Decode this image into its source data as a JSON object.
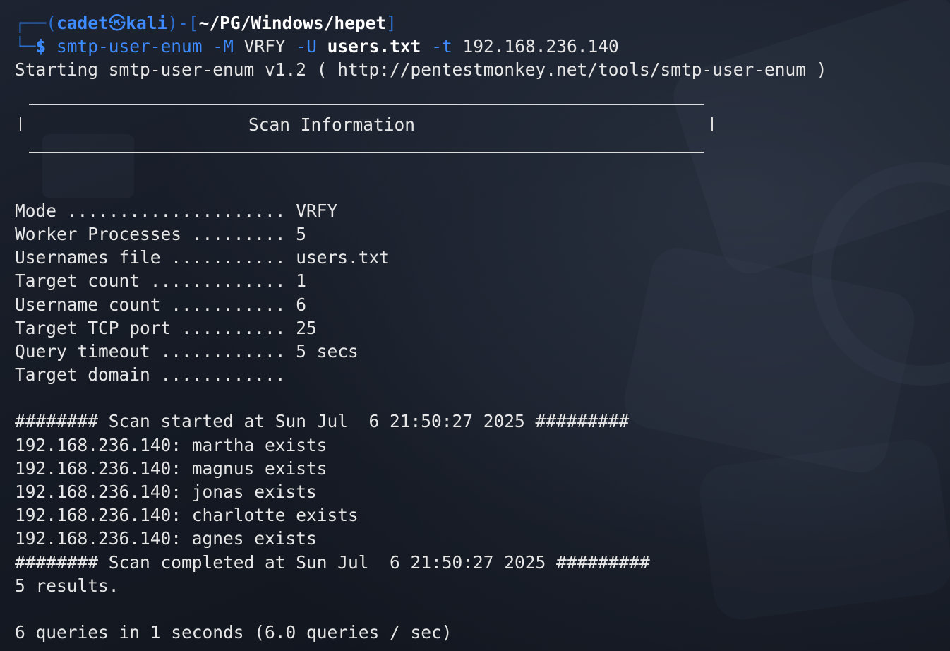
{
  "prompt": {
    "frame_top": "┌──(",
    "user": "cadet",
    "at_symbol": "㉿",
    "host": "kali",
    "frame_mid": ")-[",
    "path": "~/PG/Windows/hepet",
    "frame_end": "]",
    "frame_bottom": "└─",
    "dollar": "$"
  },
  "command": {
    "program": "smtp-user-enum",
    "flag_mode": "-M",
    "mode_value": "VRFY",
    "flag_users": "-U",
    "users_value": "users.txt",
    "flag_target": "-t",
    "target_value": "192.168.236.140"
  },
  "output": {
    "starting": "Starting smtp-user-enum v1.2 ( http://pentestmonkey.net/tools/smtp-user-enum )",
    "banner_title": "Scan Information",
    "settings": [
      "Mode ..................... VRFY",
      "Worker Processes ......... 5",
      "Usernames file ........... users.txt",
      "Target count ............. 1",
      "Username count ........... 6",
      "Target TCP port .......... 25",
      "Query timeout ............ 5 secs",
      "Target domain ............"
    ],
    "scan_started": "######## Scan started at Sun Jul  6 21:50:27 2025 #########",
    "results": [
      "192.168.236.140: martha exists",
      "192.168.236.140: magnus exists",
      "192.168.236.140: jonas exists",
      "192.168.236.140: charlotte exists",
      "192.168.236.140: agnes exists"
    ],
    "scan_completed": "######## Scan completed at Sun Jul  6 21:50:27 2025 #########",
    "result_count": "5 results.",
    "summary": "6 queries in 1 seconds (6.0 queries / sec)"
  },
  "colors": {
    "prompt_blue": "#3d8bff",
    "frame_blue": "#2b6fd1",
    "text": "#e6e6e6",
    "background": "#151a24"
  }
}
